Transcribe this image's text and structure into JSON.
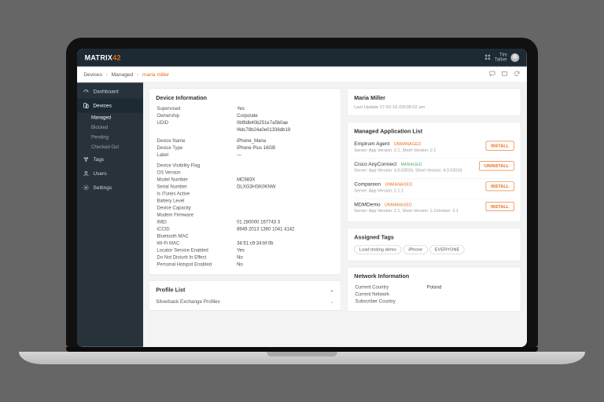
{
  "brand": {
    "name_a": "MATRIX",
    "name_b": "42",
    "user_name": "Tim\nTalker"
  },
  "crumbs": {
    "a": "Devices",
    "b": "Managed",
    "c": "maria miller"
  },
  "sidebar": {
    "items": [
      {
        "label": "Dashboard"
      },
      {
        "label": "Devices"
      },
      {
        "label": "Tags"
      },
      {
        "label": "Users"
      },
      {
        "label": "Settings"
      }
    ],
    "device_sub": [
      {
        "label": "Managed"
      },
      {
        "label": "Blocked"
      },
      {
        "label": "Pending"
      },
      {
        "label": "Checked Out"
      }
    ]
  },
  "device_info": {
    "title": "Device Information",
    "rows": [
      [
        "Supervised",
        "Yes"
      ],
      [
        "Ownership",
        "Corporate"
      ],
      [
        "UDID",
        "0bf8db40b251e7a5b0ae"
      ],
      [
        "",
        "f4dc78b24a0e01336db19"
      ],
      [
        "Device Name",
        "iPhone_Maria"
      ],
      [
        "Device Type",
        "iPhone Plus 16GB"
      ],
      [
        "Label",
        "---"
      ],
      [
        "Device Visibility Flag",
        ""
      ],
      [
        "OS Version",
        ""
      ],
      [
        "Model Number",
        "MC983X"
      ],
      [
        "Serial Number",
        "DLXG3HSK0KNW"
      ],
      [
        "Is iTunes Active",
        ""
      ],
      [
        "Battery Level",
        ""
      ],
      [
        "Device Capacity",
        ""
      ],
      [
        "Modem Firmware",
        ""
      ],
      [
        "IMEI",
        "01 280000 167743 3"
      ],
      [
        "ICCID",
        "8949 2013 1360 1041 4142"
      ],
      [
        "Bluetooth MAC",
        ""
      ],
      [
        "Wi-Fi MAC",
        "34:51:c9:34:bf:0b"
      ],
      [
        "Locator Service Enabled",
        "Yes"
      ],
      [
        "Do Not Disturb In Effect",
        "No"
      ],
      [
        "Personal Hotspot Enabled",
        "No"
      ]
    ]
  },
  "profile_list": {
    "title": "Profile List",
    "item": "Silverback Exchange Profilev"
  },
  "owner": {
    "name": "Maria Miller",
    "updated": "Last Update 17-02-16 /09:08:52 am"
  },
  "managed_apps": {
    "title": "Managed Application List",
    "rows": [
      {
        "name": "Empirum Agent",
        "status": "UNMANAGED",
        "status_cls": "st-un",
        "detail": "Server: App Version: 2.1, Short Version: 2.1",
        "btn": "INSTALL"
      },
      {
        "name": "Cisco AnyConnect",
        "status": "MANAGED",
        "status_cls": "st-mn",
        "detail": "Server: App Version: 4.0.03016, Short Version: 4.0.03016",
        "btn": "UNINSTALL"
      },
      {
        "name": "Companion",
        "status": "UNMANAGED",
        "status_cls": "st-un",
        "detail": "Server: App Version: 2.1.1",
        "btn": "INSTALL"
      },
      {
        "name": "MDMDemo",
        "status": "UNMANAGED",
        "status_cls": "st-un",
        "detail": "Server: App Version: 2.1, Short Version: 2.1Version: 2.1",
        "btn": "INSTALL"
      }
    ]
  },
  "assigned_tags": {
    "title": "Assigned Tags",
    "tags": [
      "Load testing demo",
      "iPhone",
      "EVERYONE"
    ]
  },
  "network": {
    "title": "Network Information",
    "rows": [
      [
        "Current Country",
        "Poland"
      ],
      [
        "Current Network",
        ""
      ],
      [
        "Subscriber Country",
        ""
      ]
    ]
  }
}
